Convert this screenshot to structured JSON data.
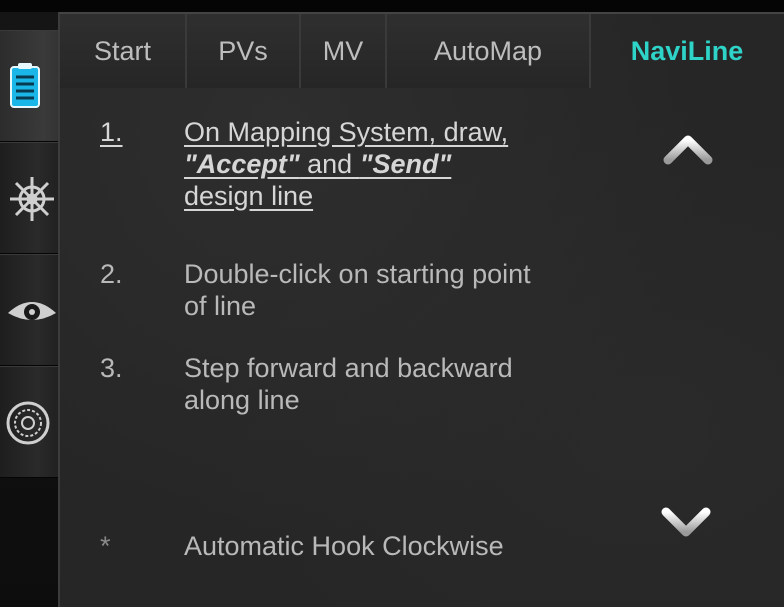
{
  "tabs": [
    {
      "label": "Start"
    },
    {
      "label": "PVs"
    },
    {
      "label": "MV"
    },
    {
      "label": "AutoMap"
    },
    {
      "label": "NaviLine",
      "active": true
    }
  ],
  "steps": [
    {
      "num": "1.",
      "line1": "On Mapping System, draw,",
      "line2_a": "\"Accept\"",
      "line2_b": " and ",
      "line2_c": "\"Send\"",
      "line3": "design line"
    },
    {
      "num": "2.",
      "line1": "Double-click on starting point",
      "line2": "of line"
    },
    {
      "num": "3.",
      "line1": "Step forward and backward",
      "line2": "along line"
    },
    {
      "num": "*",
      "line1": "Automatic Hook Clockwise"
    }
  ],
  "sidebar": {
    "icons": [
      "clipboard-icon",
      "helm-icon",
      "eye-icon",
      "dial-icon"
    ]
  },
  "colors": {
    "accent": "#2fd4c8",
    "text": "#bdbdbd",
    "panel": "#262626"
  }
}
